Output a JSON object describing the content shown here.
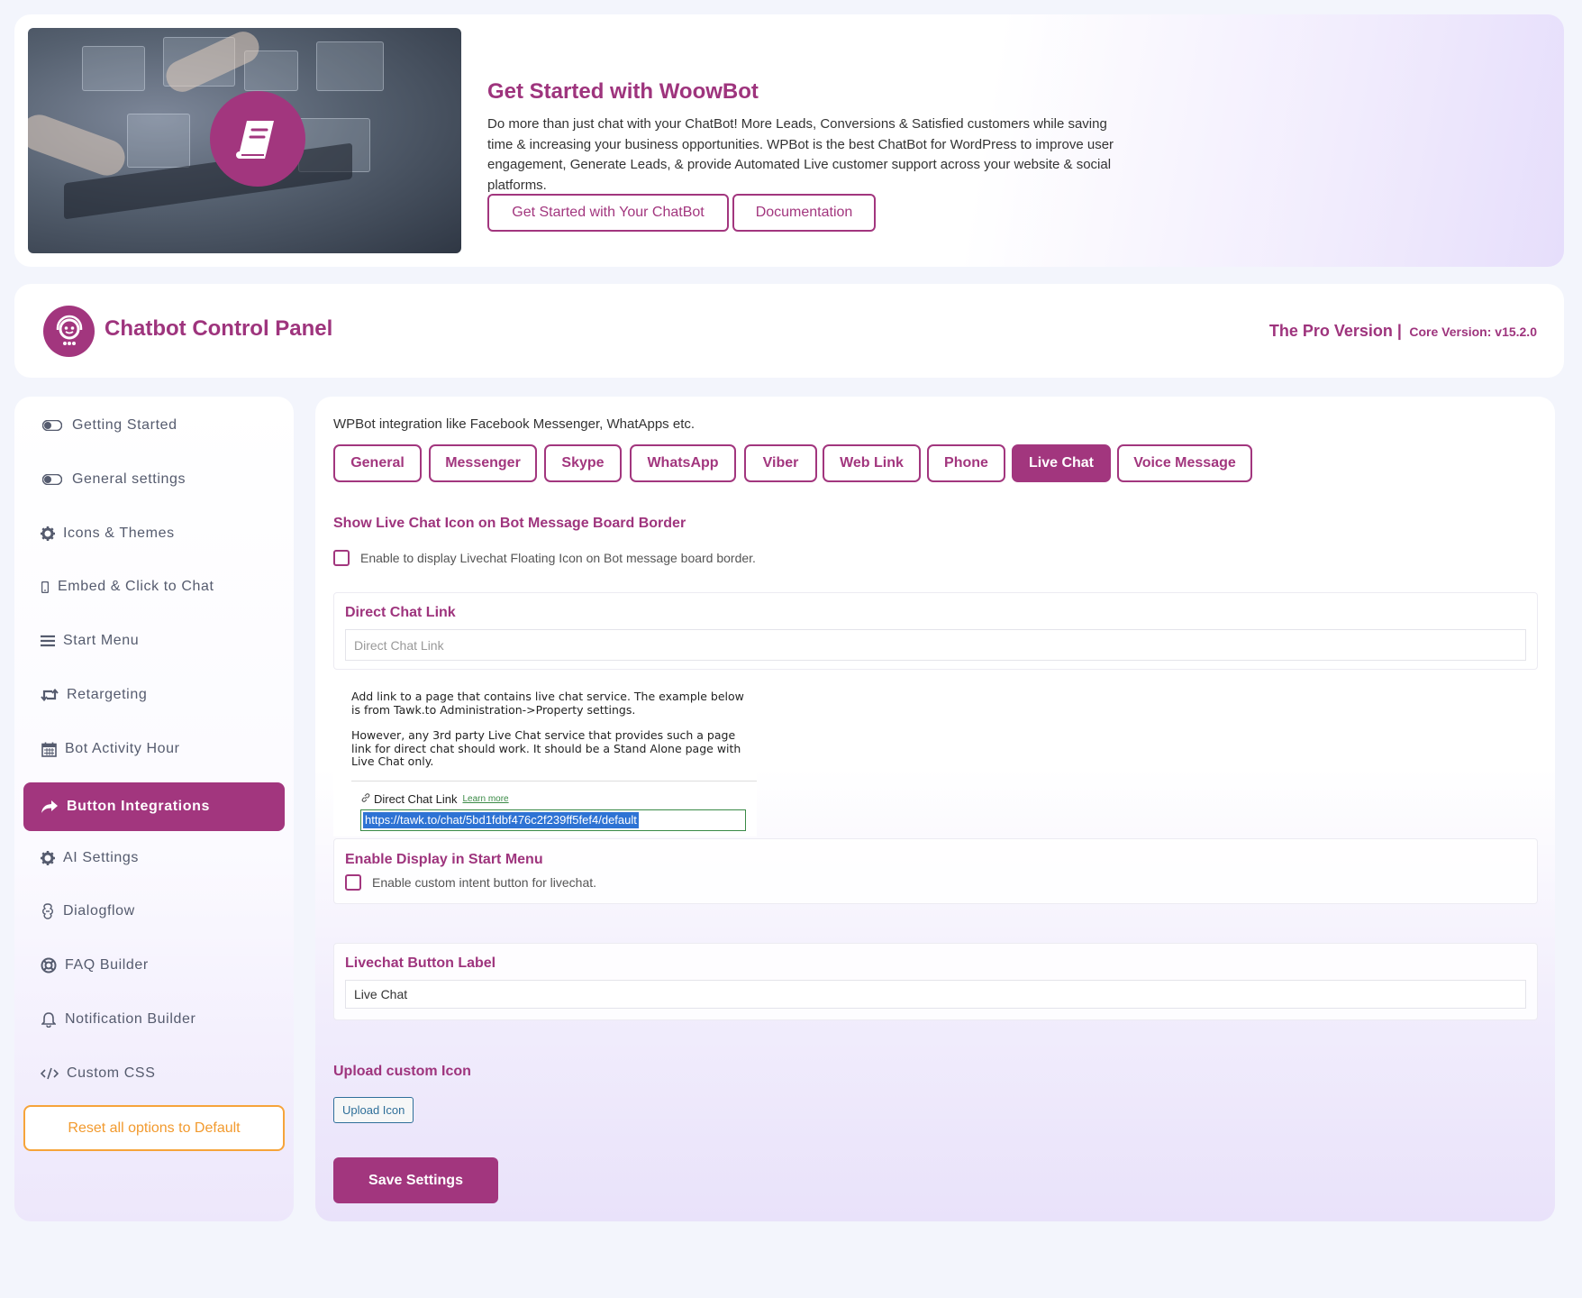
{
  "banner": {
    "title": "Get Started with WoowBot",
    "description": "Do more than just chat with your ChatBot! More Leads, Conversions & Satisfied customers while saving time & increasing your business opportunities. WPBot is the best ChatBot for WordPress to improve user engagement, Generate Leads, & provide Automated Live customer support across your website & social platforms.",
    "buttons": {
      "get_started": "Get Started with Your ChatBot",
      "documentation": "Documentation"
    }
  },
  "header": {
    "title": "Chatbot Control Panel",
    "pro_label": "The Pro Version |",
    "core_version": "Core Version: v15.2.0"
  },
  "sidebar": {
    "items": [
      {
        "label": "Getting Started",
        "icon": "toggle-icon"
      },
      {
        "label": "General settings",
        "icon": "toggle-icon"
      },
      {
        "label": "Icons & Themes",
        "icon": "gear-icon"
      },
      {
        "label": "Embed & Click to Chat",
        "icon": "mobile-icon"
      },
      {
        "label": "Start Menu",
        "icon": "menu-icon"
      },
      {
        "label": "Retargeting",
        "icon": "retweet-icon"
      },
      {
        "label": "Bot Activity Hour",
        "icon": "calendar-icon"
      },
      {
        "label": "Button Integrations",
        "icon": "share-icon",
        "active": true
      },
      {
        "label": "AI Settings",
        "icon": "gear-icon"
      },
      {
        "label": "Dialogflow",
        "icon": "dialogflow-icon"
      },
      {
        "label": "FAQ Builder",
        "icon": "lifebuoy-icon"
      },
      {
        "label": "Notification Builder",
        "icon": "bell-icon"
      },
      {
        "label": "Custom CSS",
        "icon": "code-icon"
      }
    ],
    "reset_label": "Reset all options to Default"
  },
  "main": {
    "intro": "WPBot integration like Facebook Messenger, WhatApps etc.",
    "tabs": [
      {
        "label": "General"
      },
      {
        "label": "Messenger"
      },
      {
        "label": "Skype"
      },
      {
        "label": "WhatsApp"
      },
      {
        "label": "Viber"
      },
      {
        "label": "Web Link"
      },
      {
        "label": "Phone"
      },
      {
        "label": "Live Chat",
        "active": true
      },
      {
        "label": "Voice Message"
      }
    ],
    "show_icon": {
      "title": "Show Live Chat Icon on Bot Message Board Border",
      "checkbox_label": "Enable to display Livechat Floating Icon on Bot message board border."
    },
    "direct_chat": {
      "title": "Direct Chat Link",
      "placeholder": "Direct Chat Link",
      "value": ""
    },
    "help": {
      "paragraph1": "Add link to a page that contains live chat service. The example below is from Tawk.to Administration->Property settings.",
      "paragraph2": "However, any 3rd party Live Chat service that provides such a page link for direct chat should work. It should be a Stand Alone page with Live Chat only.",
      "link_label": "Direct Chat Link",
      "learn_more": "Learn more",
      "example_url": "https://tawk.to/chat/5bd1fdbf476c2f239ff5fef4/default"
    },
    "start_menu": {
      "title": "Enable Display in Start Menu",
      "checkbox_label": "Enable custom intent button for livechat."
    },
    "button_label": {
      "title": "Livechat Button Label",
      "value": "Live Chat"
    },
    "upload": {
      "title": "Upload custom Icon",
      "button": "Upload Icon"
    },
    "save_label": "Save Settings"
  },
  "colors": {
    "brand": "#a2367e",
    "reset": "#f6a43a"
  }
}
